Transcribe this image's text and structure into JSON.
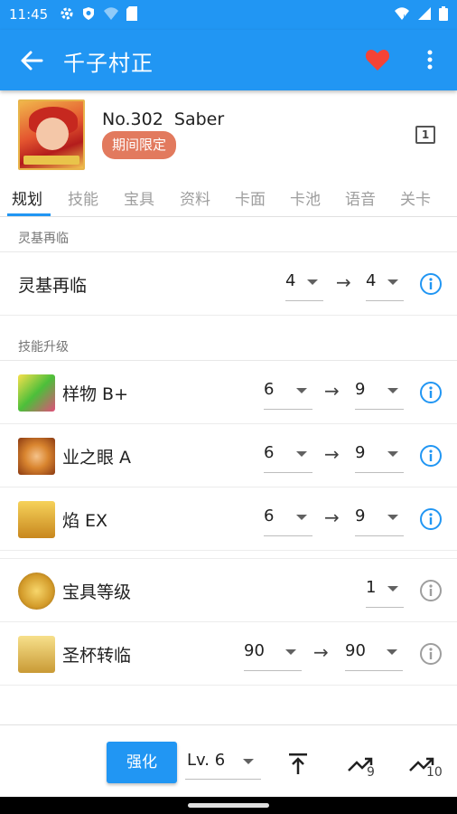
{
  "status_bar": {
    "time": "11:45"
  },
  "app_bar": {
    "title": "千子村正"
  },
  "servant": {
    "number": "No.302",
    "class": "Saber",
    "badge": "期间限定",
    "box_number": "1"
  },
  "tabs": [
    {
      "label": "规划"
    },
    {
      "label": "技能"
    },
    {
      "label": "宝具"
    },
    {
      "label": "资料"
    },
    {
      "label": "卡面"
    },
    {
      "label": "卡池"
    },
    {
      "label": "语音"
    },
    {
      "label": "关卡"
    }
  ],
  "sections": {
    "ascension_header": "灵基再临",
    "skill_header": "技能升级"
  },
  "ascension": {
    "label": "灵基再临",
    "from": "4",
    "to": "4"
  },
  "skills": [
    {
      "label": "样物 B+",
      "from": "6",
      "to": "9"
    },
    {
      "label": "业之眼 A",
      "from": "6",
      "to": "9"
    },
    {
      "label": "焰 EX",
      "from": "6",
      "to": "9"
    }
  ],
  "np_level": {
    "label": "宝具等级",
    "value": "1"
  },
  "grail": {
    "label": "圣杯转临",
    "from": "90",
    "to": "90"
  },
  "arrow_symbol": "→",
  "bottom_bar": {
    "enhance_label": "强化",
    "level": "Lv. 6",
    "max9_sub": "9",
    "max10_sub": "10"
  },
  "colors": {
    "primary": "#2196f3",
    "badge": "#e27a5e",
    "heart": "#f44336"
  }
}
